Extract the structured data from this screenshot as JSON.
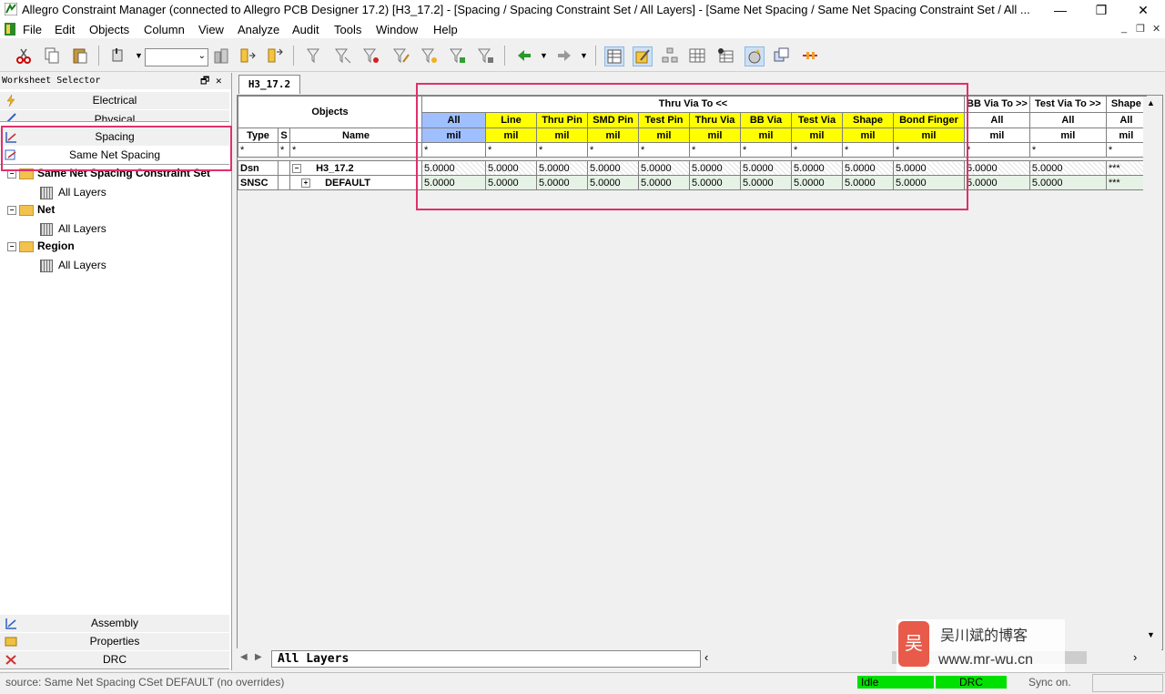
{
  "window": {
    "title": "Allegro Constraint Manager (connected to Allegro PCB Designer 17.2) [H3_17.2] - [Spacing / Spacing Constraint Set / All Layers] - [Same Net Spacing / Same Net Spacing Constraint Set / All ...",
    "minimize": "—",
    "restore": "❐",
    "close": "✕"
  },
  "menu": [
    "File",
    "Edit",
    "Objects",
    "Column",
    "View",
    "Analyze",
    "Audit",
    "Tools",
    "Window",
    "Help"
  ],
  "mdi": {
    "min": "_",
    "restore": "❐",
    "close": "✕"
  },
  "worksheet": {
    "header": "Worksheet Selector",
    "pin": "🗗",
    "close": "✕",
    "items_top": [
      "Electrical",
      "Physical",
      "Spacing",
      "Same Net Spacing"
    ],
    "items_bottom": [
      "Assembly",
      "Properties",
      "DRC"
    ],
    "tree": [
      {
        "label": "Same Net Spacing Constraint Set",
        "bold": true
      },
      {
        "label": "All Layers",
        "bold": false
      },
      {
        "label": "Net",
        "bold": true
      },
      {
        "label": "All Layers",
        "bold": false
      },
      {
        "label": "Region",
        "bold": true
      },
      {
        "label": "All Layers",
        "bold": false
      }
    ]
  },
  "doc_tab": "H3_17.2",
  "grid": {
    "objects_header": "Objects",
    "thru_via_header": "Thru Via To <<",
    "bb_via_header": "BB Via To >>",
    "test_via_header": "Test Via To >>",
    "shape_header": "Shape",
    "type_header": "Type",
    "s_header": "S",
    "name_header": "Name",
    "sub_columns": [
      "All",
      "Line",
      "Thru Pin",
      "SMD Pin",
      "Test Pin",
      "Thru Via",
      "BB Via",
      "Test Via",
      "Shape",
      "Bond Finger"
    ],
    "right_sub": [
      "All",
      "All",
      "All"
    ],
    "unit": "mil",
    "star": "*",
    "rows": [
      {
        "type": "Dsn",
        "expander": "−",
        "name": "H3_17.2",
        "values": [
          "5.0000",
          "5.0000",
          "5.0000",
          "5.0000",
          "5.0000",
          "5.0000",
          "5.0000",
          "5.0000",
          "5.0000",
          "5.0000"
        ],
        "right": [
          "5.0000",
          "5.0000",
          "***"
        ]
      },
      {
        "type": "SNSC",
        "expander": "+",
        "name": "DEFAULT",
        "values": [
          "5.0000",
          "5.0000",
          "5.0000",
          "5.0000",
          "5.0000",
          "5.0000",
          "5.0000",
          "5.0000",
          "5.0000",
          "5.0000"
        ],
        "right": [
          "5.0000",
          "5.0000",
          "***"
        ]
      }
    ]
  },
  "sheet_tab": "All Layers",
  "status": {
    "source": "source: Same Net Spacing CSet DEFAULT (no overrides)",
    "idle": "Idle",
    "drc": "DRC",
    "sync": "Sync on."
  },
  "watermark": {
    "name": "吴川斌的博客",
    "url": "www.mr-wu.cn"
  },
  "colors": {
    "highlight": "#e0306b",
    "yellow": "#ffff00",
    "blue": "#a0bfff",
    "green": "#00e000"
  }
}
